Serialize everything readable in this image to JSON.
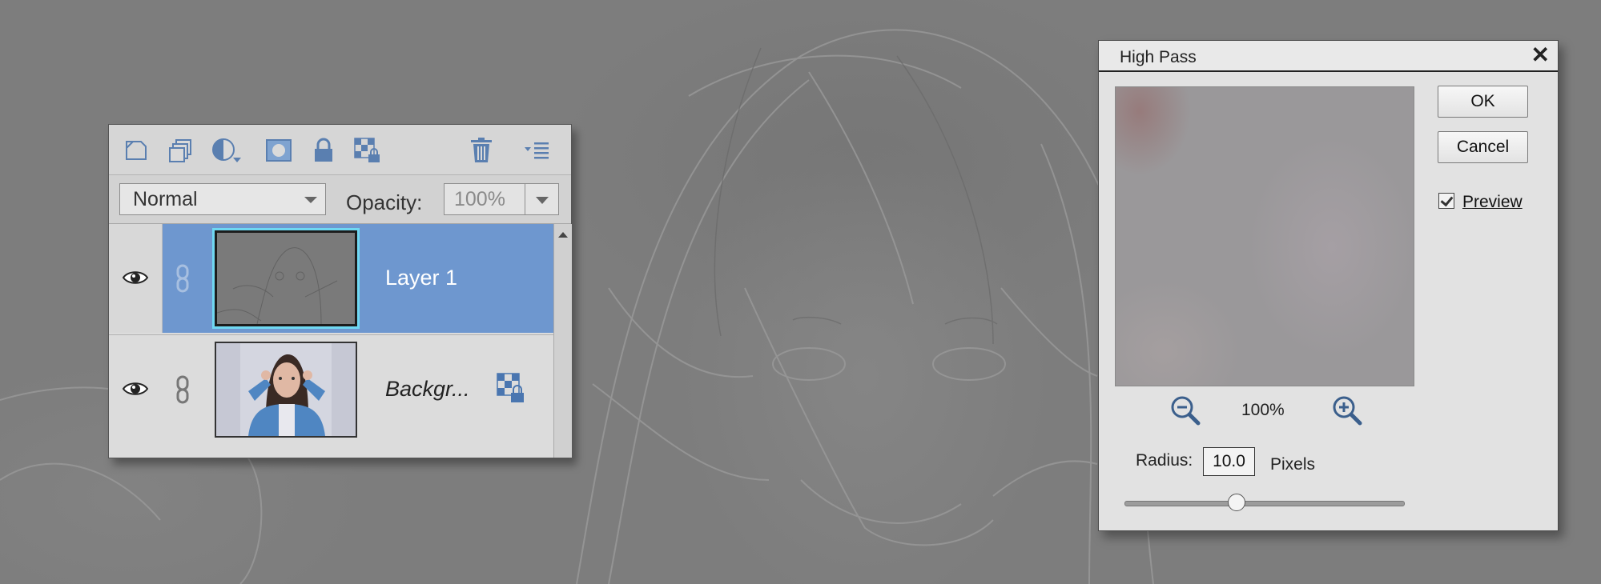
{
  "layers_panel": {
    "toolbar_icons": [
      "new-layer-icon",
      "duplicate-layer-icon",
      "adjustment-layer-icon",
      "layer-mask-icon",
      "lock-all-icon",
      "lock-transparent-icon",
      "delete-layer-icon",
      "panel-menu-icon"
    ],
    "blend_mode": "Normal",
    "opacity_label": "Opacity:",
    "opacity_value": "100%",
    "layers": [
      {
        "name": "Layer 1",
        "selected": true,
        "visible": true
      },
      {
        "name": "Backgr...",
        "selected": false,
        "visible": true,
        "locked": true
      }
    ],
    "accent_color": "#6e97cf",
    "thumbnail_outline_color": "#6fd8f2"
  },
  "high_pass_dialog": {
    "title": "High Pass",
    "ok_label": "OK",
    "cancel_label": "Cancel",
    "preview_label": "Preview",
    "preview_checked": true,
    "zoom_value": "100%",
    "radius_label": "Radius:",
    "radius_value": "10.0",
    "radius_unit": "Pixels",
    "radius_slider_fraction": 0.4
  }
}
